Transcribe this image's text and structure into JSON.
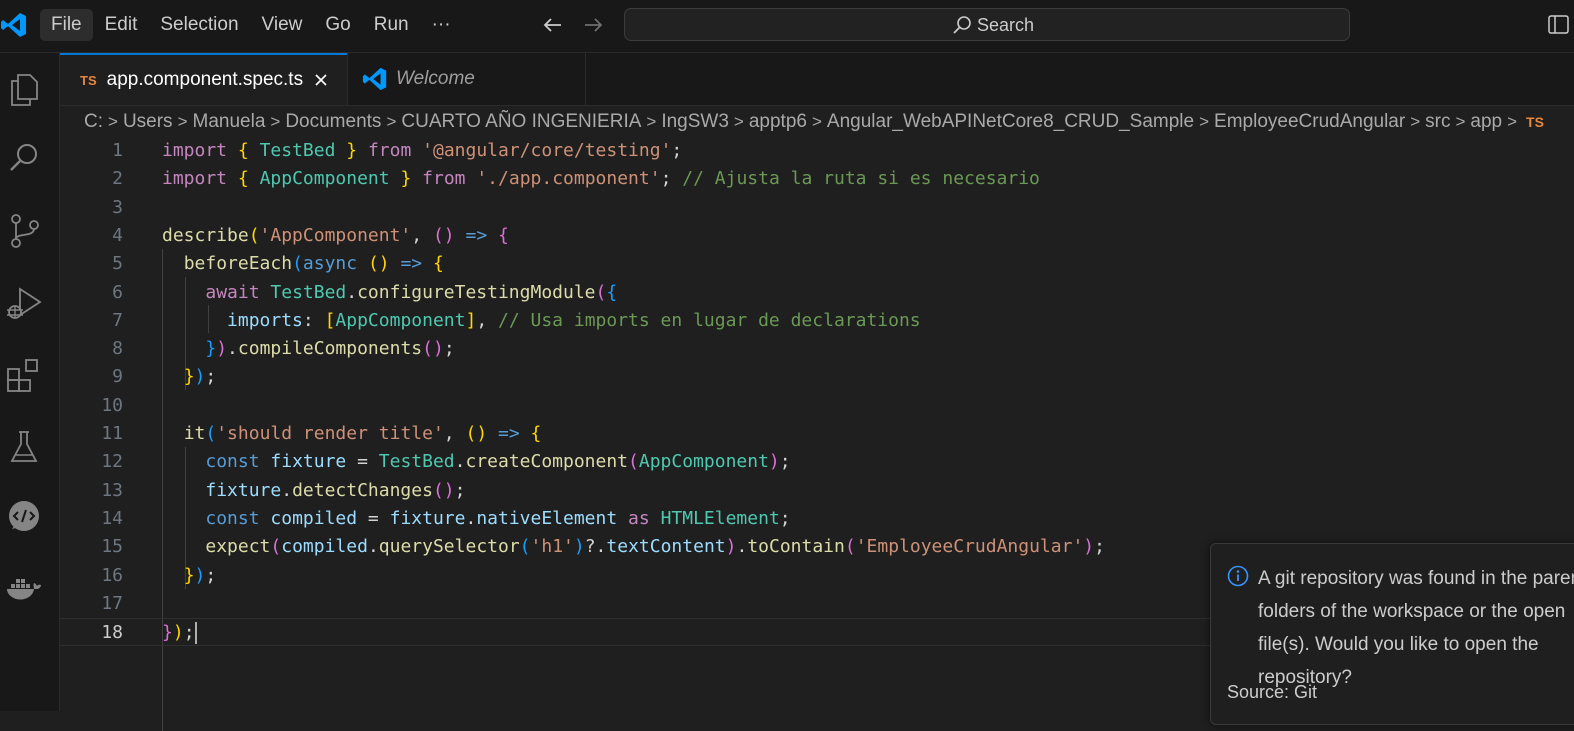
{
  "menu": [
    "File",
    "Edit",
    "Selection",
    "View",
    "Go",
    "Run",
    "···"
  ],
  "search": {
    "label": "Search"
  },
  "tabs": [
    {
      "badge": "TS",
      "label": "app.component.spec.ts"
    },
    {
      "label": "Welcome"
    }
  ],
  "breadcrumb": {
    "parts": [
      "C:",
      "Users",
      "Manuela",
      "Documents",
      "CUARTO AÑO INGENIERIA",
      "IngSW3",
      "apptp6",
      "Angular_WebAPINetCore8_CRUD_Sample",
      "EmployeeCrudAngular",
      "src",
      "app"
    ],
    "file_badge": "TS"
  },
  "editor": {
    "line_numbers": [
      "1",
      "2",
      "3",
      "4",
      "5",
      "6",
      "7",
      "8",
      "9",
      "10",
      "11",
      "12",
      "13",
      "14",
      "15",
      "16",
      "17",
      "18"
    ],
    "current_line": "18",
    "lines": [
      [
        [
          "kw",
          "import"
        ],
        [
          "pl",
          " "
        ],
        [
          "b1",
          "{"
        ],
        [
          "pl",
          " "
        ],
        [
          "ty",
          "TestBed"
        ],
        [
          "pl",
          " "
        ],
        [
          "b1",
          "}"
        ],
        [
          "pl",
          " "
        ],
        [
          "kw",
          "from"
        ],
        [
          "pl",
          " "
        ],
        [
          "str",
          "'@angular/core/testing'"
        ],
        [
          "pl",
          ";"
        ]
      ],
      [
        [
          "kw",
          "import"
        ],
        [
          "pl",
          " "
        ],
        [
          "b1",
          "{"
        ],
        [
          "pl",
          " "
        ],
        [
          "ty",
          "AppComponent"
        ],
        [
          "pl",
          " "
        ],
        [
          "b1",
          "}"
        ],
        [
          "pl",
          " "
        ],
        [
          "kw",
          "from"
        ],
        [
          "pl",
          " "
        ],
        [
          "str",
          "'./app.component'"
        ],
        [
          "pl",
          "; "
        ],
        [
          "cm",
          "// Ajusta la ruta si es necesario"
        ]
      ],
      [],
      [
        [
          "fn",
          "describe"
        ],
        [
          "b1",
          "("
        ],
        [
          "str",
          "'AppComponent'"
        ],
        [
          "pl",
          ", "
        ],
        [
          "b2",
          "()"
        ],
        [
          "pl",
          " "
        ],
        [
          "dk",
          "=>"
        ],
        [
          "pl",
          " "
        ],
        [
          "b2",
          "{"
        ]
      ],
      [
        [
          "pl",
          "  "
        ],
        [
          "fn",
          "beforeEach"
        ],
        [
          "b3",
          "("
        ],
        [
          "dk",
          "async"
        ],
        [
          "pl",
          " "
        ],
        [
          "b1",
          "()"
        ],
        [
          "pl",
          " "
        ],
        [
          "dk",
          "=>"
        ],
        [
          "pl",
          " "
        ],
        [
          "b1",
          "{"
        ]
      ],
      [
        [
          "pl",
          "    "
        ],
        [
          "kw",
          "await"
        ],
        [
          "pl",
          " "
        ],
        [
          "ty",
          "TestBed"
        ],
        [
          "pl",
          "."
        ],
        [
          "fn",
          "configureTestingModule"
        ],
        [
          "b2",
          "("
        ],
        [
          "b3",
          "{"
        ]
      ],
      [
        [
          "pl",
          "      "
        ],
        [
          "var",
          "imports"
        ],
        [
          "pl",
          ": "
        ],
        [
          "b1",
          "["
        ],
        [
          "ty",
          "AppComponent"
        ],
        [
          "b1",
          "]"
        ],
        [
          "pl",
          ", "
        ],
        [
          "cm",
          "// Usa imports en lugar de declarations"
        ]
      ],
      [
        [
          "pl",
          "    "
        ],
        [
          "b3",
          "}"
        ],
        [
          "b2",
          ")"
        ],
        [
          "pl",
          "."
        ],
        [
          "fn",
          "compileComponents"
        ],
        [
          "b2",
          "()"
        ],
        [
          "pl",
          ";"
        ]
      ],
      [
        [
          "pl",
          "  "
        ],
        [
          "b1",
          "}"
        ],
        [
          "b3",
          ")"
        ],
        [
          "pl",
          ";"
        ]
      ],
      [],
      [
        [
          "pl",
          "  "
        ],
        [
          "fn",
          "it"
        ],
        [
          "b3",
          "("
        ],
        [
          "str",
          "'should render title'"
        ],
        [
          "pl",
          ", "
        ],
        [
          "b1",
          "()"
        ],
        [
          "pl",
          " "
        ],
        [
          "dk",
          "=>"
        ],
        [
          "pl",
          " "
        ],
        [
          "b1",
          "{"
        ]
      ],
      [
        [
          "pl",
          "    "
        ],
        [
          "dk",
          "const"
        ],
        [
          "pl",
          " "
        ],
        [
          "var",
          "fixture"
        ],
        [
          "pl",
          " = "
        ],
        [
          "ty",
          "TestBed"
        ],
        [
          "pl",
          "."
        ],
        [
          "fn",
          "createComponent"
        ],
        [
          "b2",
          "("
        ],
        [
          "ty",
          "AppComponent"
        ],
        [
          "b2",
          ")"
        ],
        [
          "pl",
          ";"
        ]
      ],
      [
        [
          "pl",
          "    "
        ],
        [
          "var",
          "fixture"
        ],
        [
          "pl",
          "."
        ],
        [
          "fn",
          "detectChanges"
        ],
        [
          "b2",
          "()"
        ],
        [
          "pl",
          ";"
        ]
      ],
      [
        [
          "pl",
          "    "
        ],
        [
          "dk",
          "const"
        ],
        [
          "pl",
          " "
        ],
        [
          "var",
          "compiled"
        ],
        [
          "pl",
          " = "
        ],
        [
          "var",
          "fixture"
        ],
        [
          "pl",
          "."
        ],
        [
          "var",
          "nativeElement"
        ],
        [
          "pl",
          " "
        ],
        [
          "kw",
          "as"
        ],
        [
          "pl",
          " "
        ],
        [
          "ty",
          "HTMLElement"
        ],
        [
          "pl",
          ";"
        ]
      ],
      [
        [
          "pl",
          "    "
        ],
        [
          "fn",
          "expect"
        ],
        [
          "b2",
          "("
        ],
        [
          "var",
          "compiled"
        ],
        [
          "pl",
          "."
        ],
        [
          "fn",
          "querySelector"
        ],
        [
          "b3",
          "("
        ],
        [
          "str",
          "'h1'"
        ],
        [
          "b3",
          ")"
        ],
        [
          "pl",
          "?."
        ],
        [
          "var",
          "textContent"
        ],
        [
          "b2",
          ")"
        ],
        [
          "pl",
          "."
        ],
        [
          "fn",
          "toContain"
        ],
        [
          "b2",
          "("
        ],
        [
          "str",
          "'EmployeeCrudAngular'"
        ],
        [
          "b2",
          ")"
        ],
        [
          "pl",
          ";"
        ]
      ],
      [
        [
          "pl",
          "  "
        ],
        [
          "b1",
          "}"
        ],
        [
          "b3",
          ")"
        ],
        [
          "pl",
          ";"
        ]
      ],
      [],
      [
        [
          "b2",
          "}"
        ],
        [
          "b1",
          ")"
        ],
        [
          "pl",
          ";"
        ]
      ]
    ]
  },
  "notification": {
    "message": "A git repository was found in the parent folders of the workspace or the open file(s). Would you like to open the repository?",
    "source": "Source: Git"
  },
  "colors": {
    "accent": "#0078d4",
    "ts_badge": "#e8863a",
    "info": "#3794ff"
  }
}
